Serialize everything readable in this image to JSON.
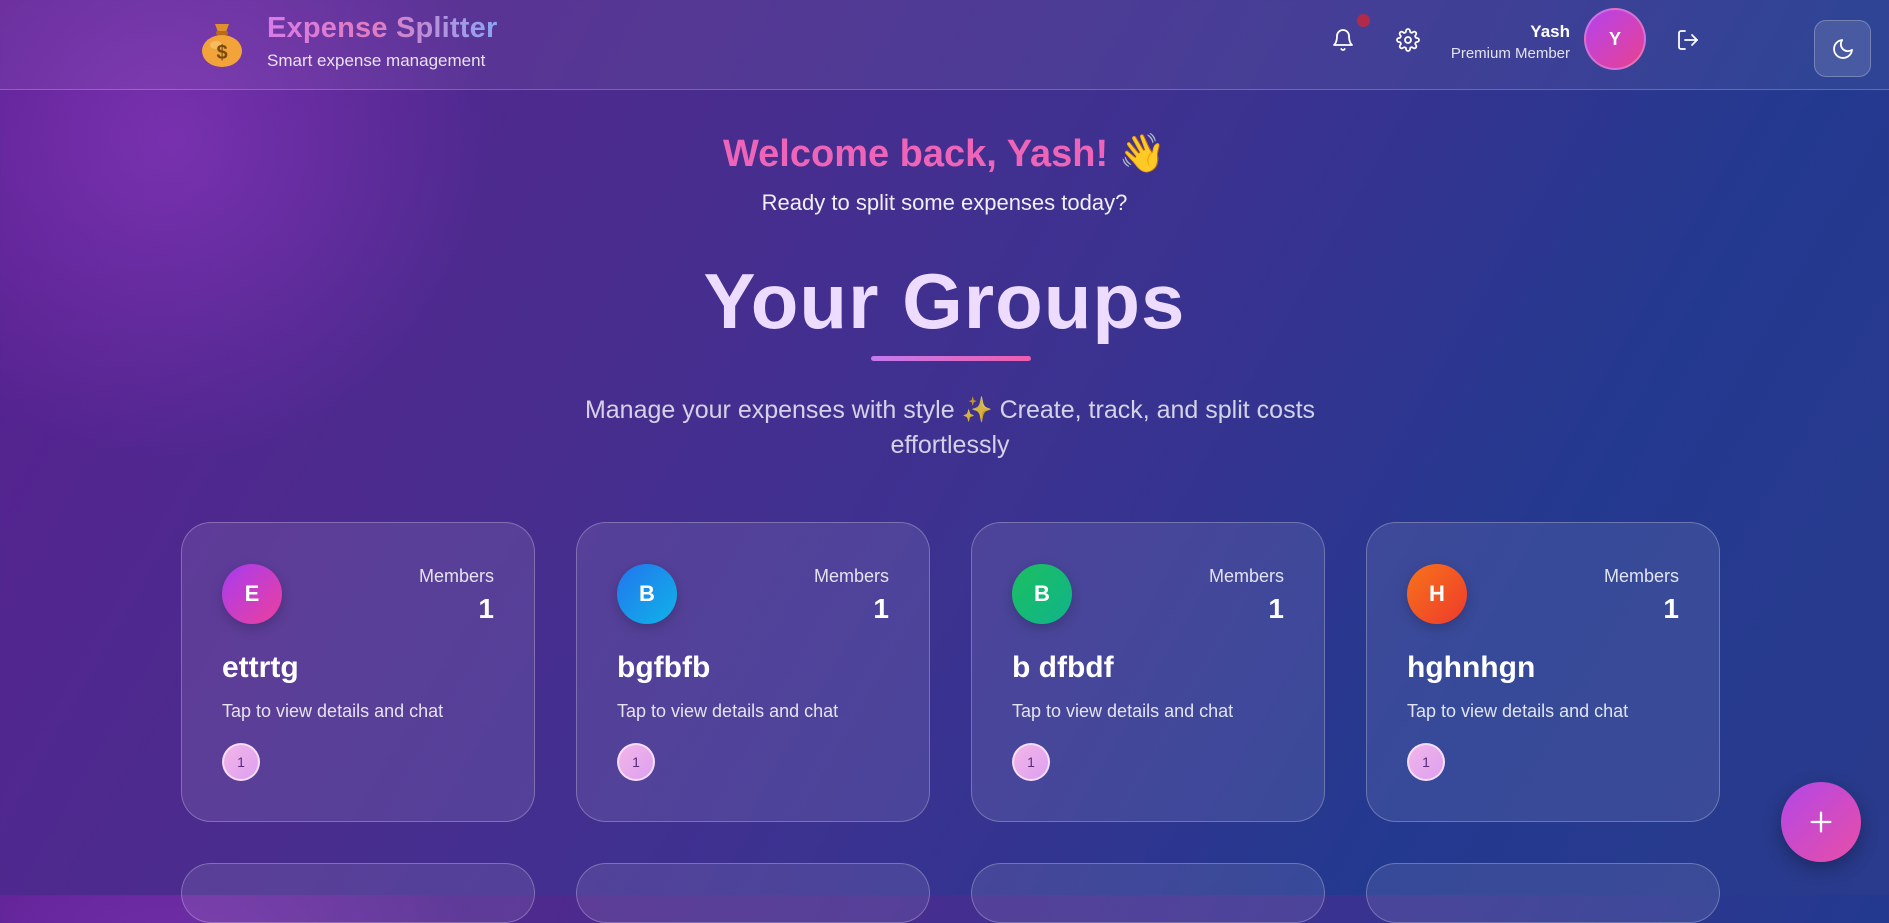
{
  "header": {
    "logo_icon": "money-bag-icon",
    "title": "Expense Splitter",
    "subtitle": "Smart expense management",
    "user": {
      "name": "Yash",
      "role": "Premium Member",
      "avatar_initial": "Y"
    },
    "icons": [
      "bell-icon",
      "gear-icon",
      "logout-icon",
      "moon-icon"
    ]
  },
  "welcome": {
    "greeting": "Welcome back, Yash!",
    "emoji": "👋",
    "subtitle": "Ready to split some expenses today?"
  },
  "groups_section": {
    "heading": "Your Groups",
    "description": "Manage your expenses with style ✨ Create, track, and split costs effortlessly"
  },
  "groups": [
    {
      "initial": "E",
      "name": "ettrtg",
      "members_label": "Members",
      "members_count": "1",
      "hint": "Tap to view details and chat",
      "member_chip": "1",
      "color": "#c13ee6"
    },
    {
      "initial": "B",
      "name": "bgfbfb",
      "members_label": "Members",
      "members_count": "1",
      "hint": "Tap to view details and chat",
      "member_chip": "1",
      "color": "#1e8ee8"
    },
    {
      "initial": "B",
      "name": "b dfbdf",
      "members_label": "Members",
      "members_count": "1",
      "hint": "Tap to view details and chat",
      "member_chip": "1",
      "color": "#13b86a"
    },
    {
      "initial": "H",
      "name": "hghnhgn",
      "members_label": "Members",
      "members_count": "1",
      "hint": "Tap to view details and chat",
      "member_chip": "1",
      "color": "#f25a1c"
    }
  ],
  "fab": {
    "icon": "plus-icon"
  },
  "colors": {
    "accent_pink": "#ee64b8",
    "heading": "#eddcff"
  }
}
